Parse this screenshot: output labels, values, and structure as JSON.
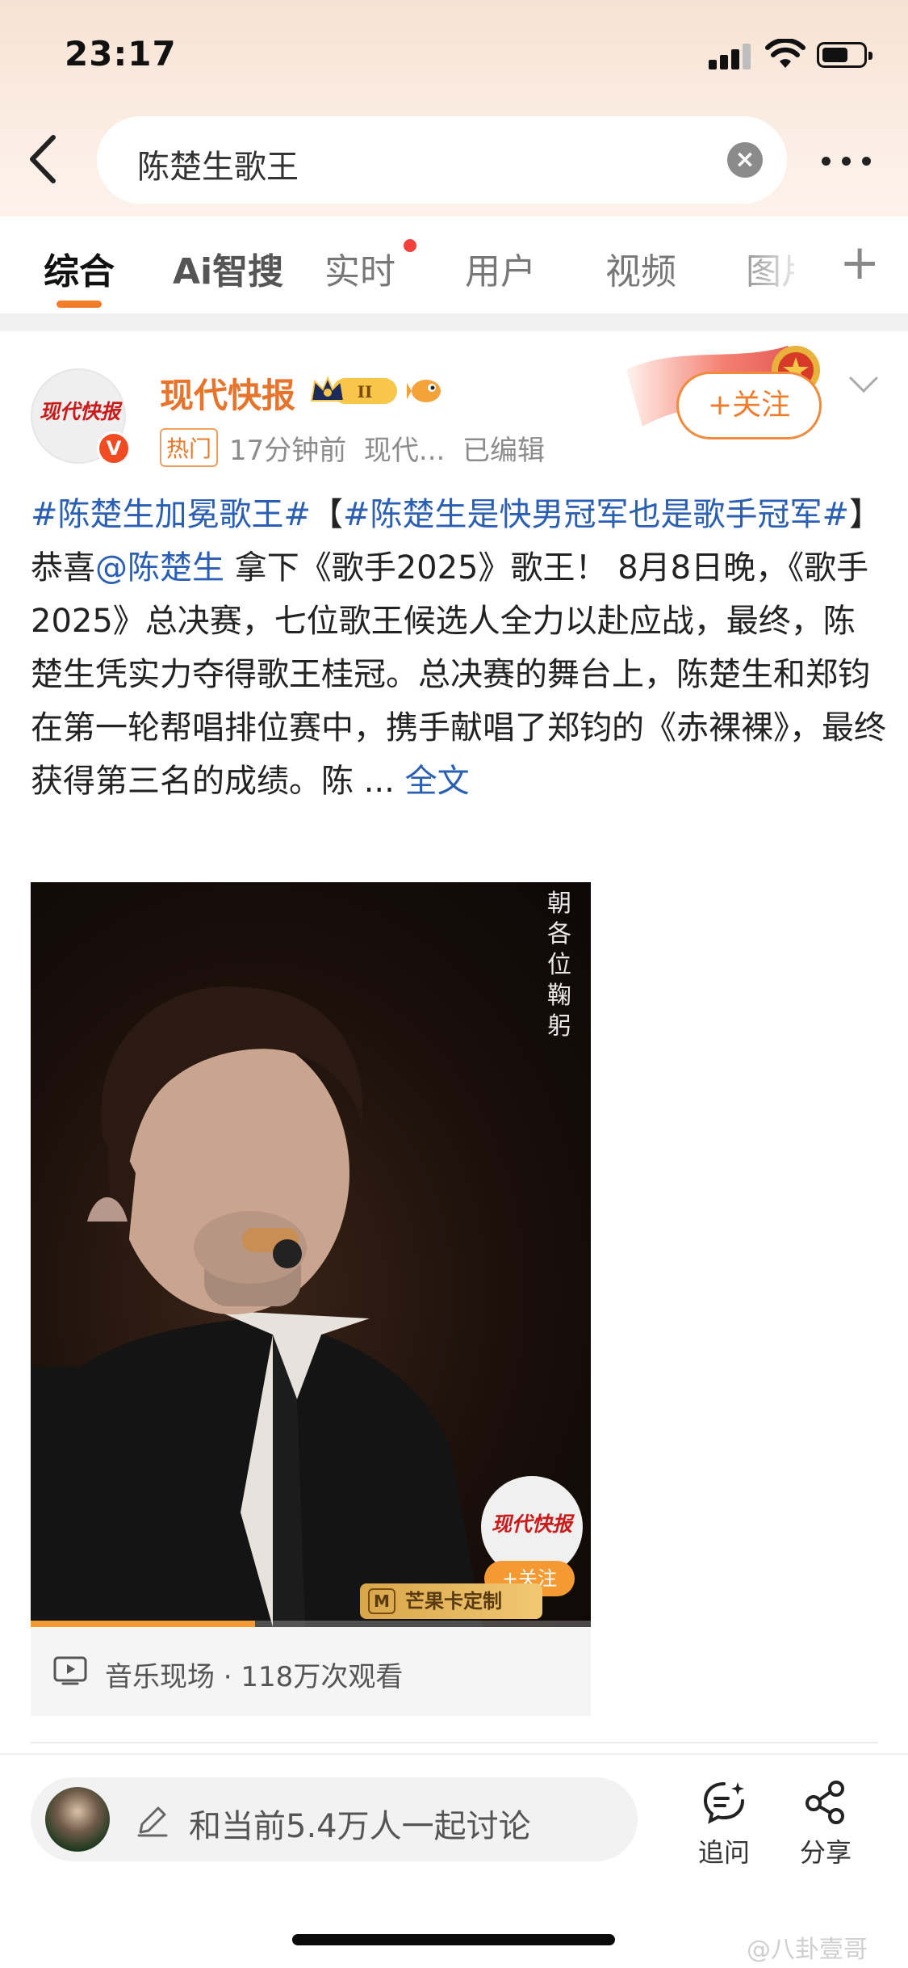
{
  "status_bar": {
    "time": "23:17",
    "battery_level": 0.65
  },
  "search": {
    "query": "陈楚生歌王"
  },
  "tabs": [
    {
      "label": "综合",
      "active": true
    },
    {
      "label": "Ai智搜",
      "active": false
    },
    {
      "label": "实时",
      "active": false,
      "has_dot": true
    },
    {
      "label": "用户",
      "active": false
    },
    {
      "label": "视频",
      "active": false
    },
    {
      "label": "图片",
      "active": false
    }
  ],
  "post": {
    "avatar_logo_text": "现代快报",
    "verified_badge": "V",
    "author": "现代快报",
    "level_badge": "II",
    "hot_label": "热门",
    "time_ago": "17分钟前",
    "source": "现代...",
    "edited": "已编辑",
    "follow_label": "+关注",
    "tag1": "#陈楚生加冕歌王#",
    "bracket_open": "【",
    "tag2": "#陈楚生是快男冠军也是歌手冠军#",
    "bracket_close": "】恭喜",
    "mention": "@陈楚生",
    "body": " 拿下《歌手2025》歌王！ 8月8日晚，《歌手2025》总决赛，七位歌王候选人全力以赴应战，最终，陈楚生凭实力夺得歌王桂冠。总决赛的舞台上，陈楚生和郑钧在第一轮帮唱排位赛中，携手献唱了郑钧的《赤裸裸》，最终获得第三名的成绩。陈 ...",
    "full_text_link": "全文"
  },
  "video": {
    "overlay_caption": "朝各位鞠躬",
    "watermark_logo_text": "现代快报",
    "watermark_follow": "+关注",
    "mango_label": "芒果卡定制",
    "progress": 0.4,
    "info": "音乐现场 · 118万次观看"
  },
  "bottom_bar": {
    "comment_placeholder": "和当前5.4万人一起讨论",
    "follow_up_label": "追问",
    "share_label": "分享"
  },
  "watermark": "@八卦壹哥"
}
